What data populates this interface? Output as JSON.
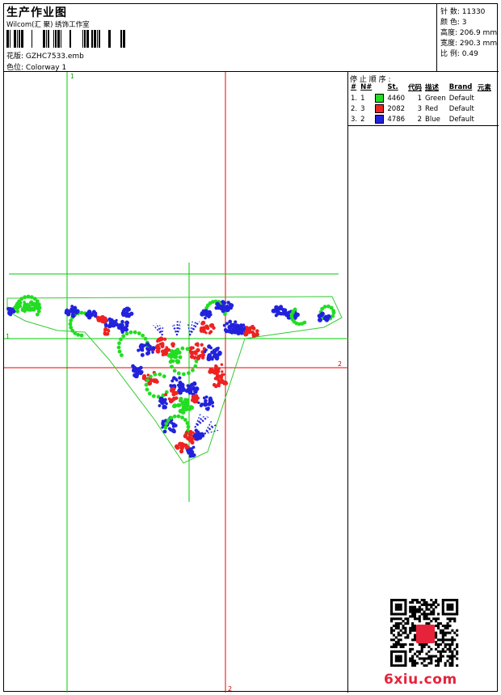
{
  "header": {
    "title": "生产作业图",
    "company": "Wilcom(汇 聚) 绣饰工作室",
    "design_label": "花版:",
    "design_value": "GZHC7533.emb",
    "colorway_label": "色位:",
    "colorway_value": "Colorway 1"
  },
  "stats": [
    {
      "label": "针 数:",
      "value": "11330"
    },
    {
      "label": "颜 色:",
      "value": "3"
    },
    {
      "label": "高度:",
      "value": "206.9 mm"
    },
    {
      "label": "宽度:",
      "value": "290.3 mm"
    },
    {
      "label": "比 例:",
      "value": "0.49"
    }
  ],
  "stop_sequence": {
    "title": "停 止 顺 序 :",
    "headers": [
      "#",
      "N#",
      "St.",
      "代码",
      "描述",
      "Brand",
      "元素"
    ],
    "rows": [
      {
        "order": "1.",
        "n": "1",
        "color": "#22dd22",
        "stitches": "4460",
        "code": "1",
        "desc": "Green",
        "brand": "Default"
      },
      {
        "order": "2.",
        "n": "3",
        "color": "#ee2222",
        "stitches": "2082",
        "code": "3",
        "desc": "Red",
        "brand": "Default"
      },
      {
        "order": "3.",
        "n": "2",
        "color": "#2222dd",
        "stitches": "4786",
        "code": "2",
        "desc": "Blue",
        "brand": "Default"
      }
    ]
  },
  "canvas": {
    "guide_labels": {
      "green_top": "1",
      "green_left": "1",
      "red_right": "2",
      "red_bottom": "2"
    },
    "colors": {
      "guide_green": "#00cc00",
      "guide_red": "#ee0000",
      "outline": "#33cc33"
    }
  },
  "watermark": {
    "logo": "6xiu.com"
  }
}
